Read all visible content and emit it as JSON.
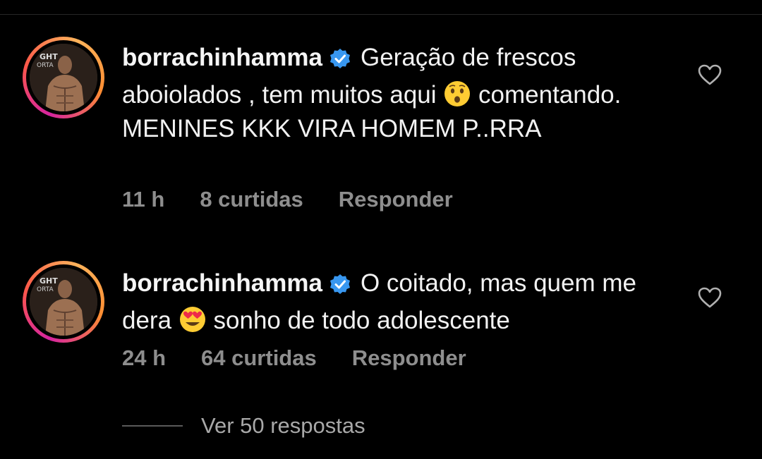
{
  "comments": [
    {
      "username": "borrachinhamma",
      "text_parts": [
        "Geração de frescos aboiolados , tem muitos aqui",
        "comentando. MENINES KKK VIRA HOMEM P..RRA"
      ],
      "emoji": "hushed-face-emoji",
      "time": "11 h",
      "likes": "8 curtidas",
      "reply_label": "Responder"
    },
    {
      "username": "borrachinhamma",
      "text_parts": [
        "O coitado, mas quem me dera",
        "sonho de todo adolescente"
      ],
      "emoji": "heart-eyes-emoji",
      "time": "24 h",
      "likes": "64 curtidas",
      "reply_label": "Responder"
    }
  ],
  "view_replies": "Ver 50 respostas",
  "colors": {
    "background": "#000000",
    "text": "#f5f5f5",
    "muted": "#8e8e8e",
    "verified": "#3897f0"
  }
}
